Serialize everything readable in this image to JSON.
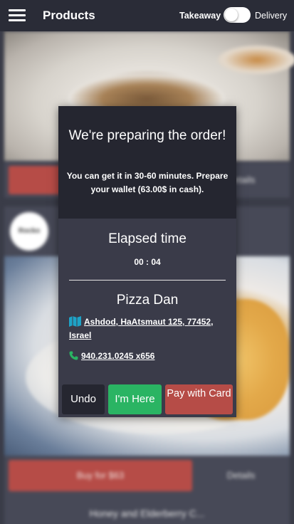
{
  "header": {
    "title": "Products",
    "mode_left": "Takeaway",
    "mode_right": "Delivery"
  },
  "background": {
    "card1": {
      "details_label": "Details"
    },
    "card2": {
      "logo_text": "Rocko",
      "buy_label": "Buy for $63",
      "details_label": "Details"
    },
    "card3": {
      "title": "Honey and Elderberry C..."
    }
  },
  "modal": {
    "title": "We're preparing the order!",
    "message": "You can get it in 30-60 minutes. Prepare your wallet (63.00$ in cash).",
    "elapsed_label": "Elapsed time",
    "elapsed_value": "00 : 04",
    "restaurant_name": "Pizza Dan",
    "address": "Ashdod, HaAtsmaut 125, 77452, Israel",
    "phone": "940.231.0245 x656",
    "buttons": {
      "undo": "Undo",
      "im_here": "I'm Here",
      "pay_with_card": "Pay with Card"
    }
  },
  "colors": {
    "accent_red": "#b64c47",
    "accent_green": "#2ab463",
    "icon_teal": "#1ea3c7",
    "phone_green": "#2ab463"
  }
}
